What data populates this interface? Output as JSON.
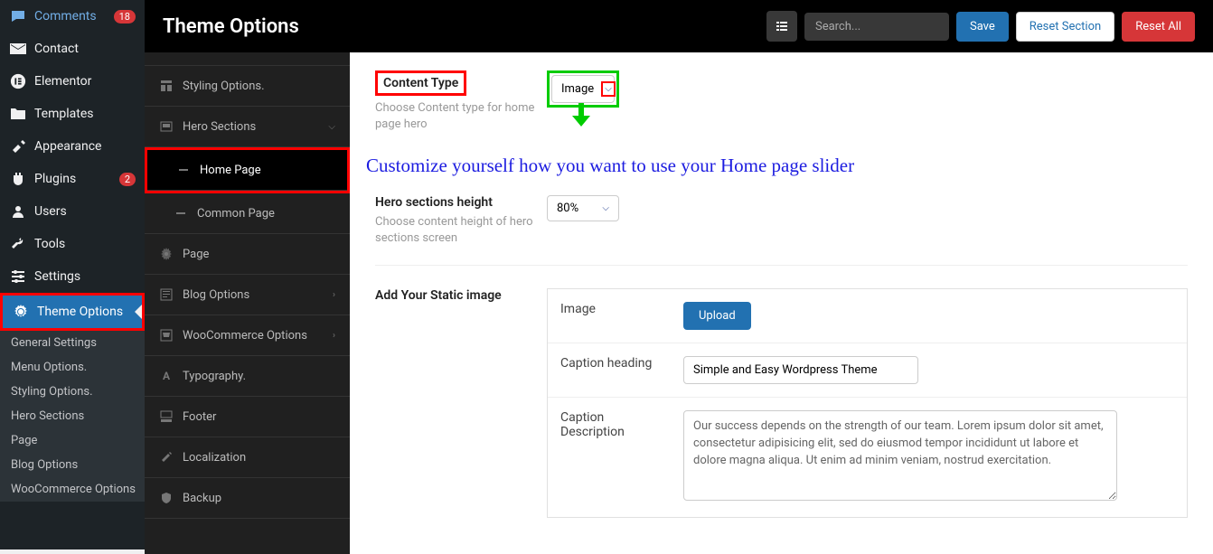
{
  "header": {
    "title": "Theme Options",
    "search_placeholder": "Search...",
    "save": "Save",
    "reset_section": "Reset Section",
    "reset_all": "Reset All"
  },
  "admin_sidebar": {
    "comments": "Comments",
    "comments_badge": "18",
    "contact": "Contact",
    "elementor": "Elementor",
    "templates": "Templates",
    "appearance": "Appearance",
    "plugins": "Plugins",
    "plugins_badge": "2",
    "users": "Users",
    "tools": "Tools",
    "settings": "Settings",
    "theme_options": "Theme Options",
    "sub": {
      "general": "General Settings",
      "menu": "Menu Options.",
      "styling": "Styling Options.",
      "hero": "Hero Sections",
      "page": "Page",
      "blog": "Blog Options",
      "woo": "WooCommerce Options"
    }
  },
  "sec_sidebar": {
    "styling": "Styling Options.",
    "hero": "Hero Sections",
    "home_page": "Home Page",
    "common_page": "Common Page",
    "page": "Page",
    "blog": "Blog Options",
    "woo": "WooCommerce Options",
    "typography": "Typography.",
    "footer": "Footer",
    "localization": "Localization",
    "backup": "Backup"
  },
  "fields": {
    "content_type": {
      "label": "Content Type",
      "desc": "Choose Content type for home page hero",
      "value": "Image"
    },
    "hero_height": {
      "label": "Hero sections height",
      "desc": "Choose content height of hero sections screen",
      "value": "80%"
    },
    "static_image_label": "Add Your Static image",
    "image": {
      "label": "Image",
      "button": "Upload"
    },
    "caption_heading": {
      "label": "Caption heading",
      "value": "Simple and Easy Wordpress Theme"
    },
    "caption_desc": {
      "label": "Caption Description",
      "value": "Our success depends on the strength of our team. Lorem ipsum dolor sit amet, consectetur adipisicing elit, sed do eiusmod tempor incididunt ut labore et dolore magna aliqua. Ut enim ad minim veniam, nostrud exercitation."
    }
  },
  "note": "Customize yourself how you want to use your Home page slider"
}
